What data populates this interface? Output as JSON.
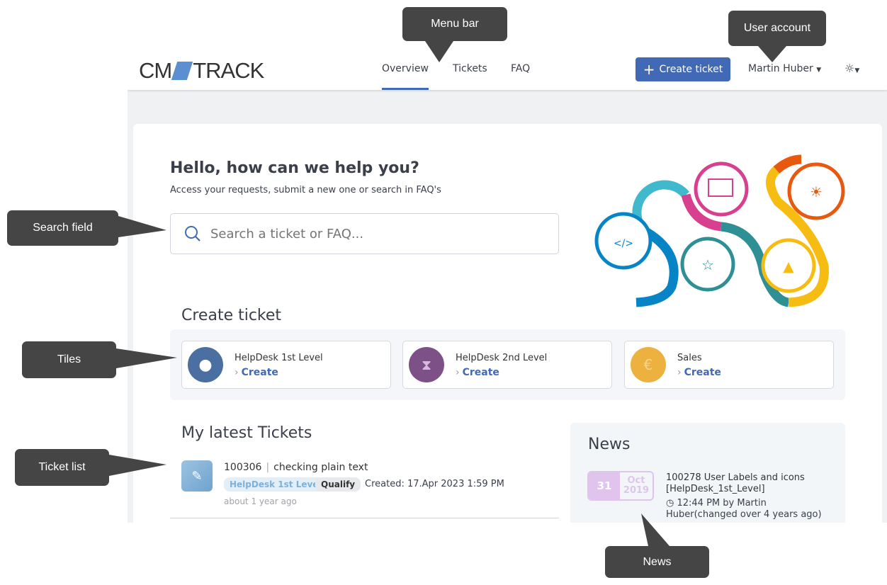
{
  "header": {
    "logo_left": "CM",
    "logo_right": "TRACK",
    "nav": [
      {
        "label": "Overview",
        "active": true
      },
      {
        "label": "Tickets"
      },
      {
        "label": "FAQ"
      }
    ],
    "create_button": "Create ticket",
    "user": "Martin Huber",
    "theme_icon": "sun-icon"
  },
  "hero": {
    "title": "Hello, how can we help you?",
    "subtitle": "Access your requests, submit a new one or search in FAQ's",
    "search_placeholder": "Search a ticket or FAQ..."
  },
  "create": {
    "title": "Create ticket",
    "tiles": [
      {
        "name": "HelpDesk 1st Level",
        "action": "Create",
        "color": "#4a6fa0",
        "icon": "lightbulb-icon"
      },
      {
        "name": "HelpDesk 2nd Level",
        "action": "Create",
        "color": "#7d5088",
        "icon": "hourglass-icon"
      },
      {
        "name": "Sales",
        "action": "Create",
        "color": "#ecb13f",
        "icon": "euro-document-icon"
      }
    ]
  },
  "tickets": {
    "title": "My latest Tickets",
    "items": [
      {
        "id": "100306",
        "subject": "checking plain text",
        "category": "HelpDesk 1st Level",
        "status": "Qualify",
        "created": "Created: 17.Apr 2023 1:59 PM",
        "ago": "about 1 year ago"
      }
    ]
  },
  "news": {
    "title": "News",
    "items": [
      {
        "day": "31",
        "month": "Oct",
        "year": "2019",
        "title": "100278 User Labels and icons [HelpDesk_1st_Level]",
        "meta": "12:44 PM by Martin Huber(changed over 4 years ago)"
      }
    ]
  },
  "callouts": {
    "menu": "Menu bar",
    "user": "User account",
    "search": "Search field",
    "tiles": "Tiles",
    "tickets": "Ticket list",
    "news": "News"
  }
}
